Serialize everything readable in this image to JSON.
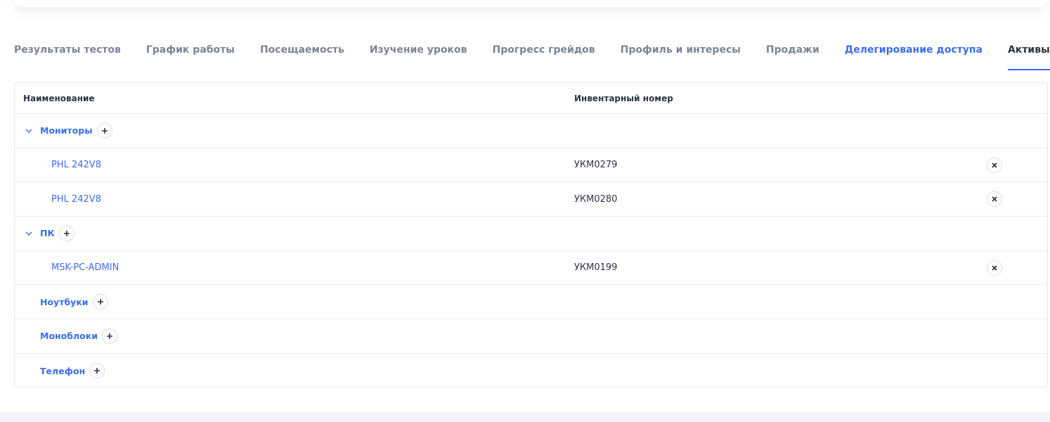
{
  "tabs": [
    {
      "label": "Результаты тестов"
    },
    {
      "label": "График работы"
    },
    {
      "label": "Посещаемость"
    },
    {
      "label": "Изучение уроков"
    },
    {
      "label": "Прогресс грейдов"
    },
    {
      "label": "Профиль и интересы"
    },
    {
      "label": "Продажи"
    },
    {
      "label": "Делегирование доступа"
    },
    {
      "label": "Активы"
    }
  ],
  "table": {
    "columns": {
      "name": "Наименование",
      "inventory": "Инвентарный номер"
    },
    "groups": [
      {
        "label": "Мониторы",
        "items": [
          {
            "name": "PHL 242V8",
            "inventory": "УКМ0279"
          },
          {
            "name": "PHL 242V8",
            "inventory": "УКМ0280"
          }
        ]
      },
      {
        "label": "ПК",
        "items": [
          {
            "name": "MSK-PC-ADMIN",
            "inventory": "УКМ0199"
          }
        ]
      },
      {
        "label": "Ноутбуки",
        "items": []
      },
      {
        "label": "Моноблоки",
        "items": []
      },
      {
        "label": "Телефон",
        "items": []
      }
    ]
  },
  "colors": {
    "accent": "#3b6ee8",
    "text": "#2e3446",
    "muted": "#7d8394",
    "border": "#e6e8ee"
  },
  "icons": {
    "expand": "chevron-down-icon",
    "add": "plus-icon",
    "remove": "close-icon"
  }
}
